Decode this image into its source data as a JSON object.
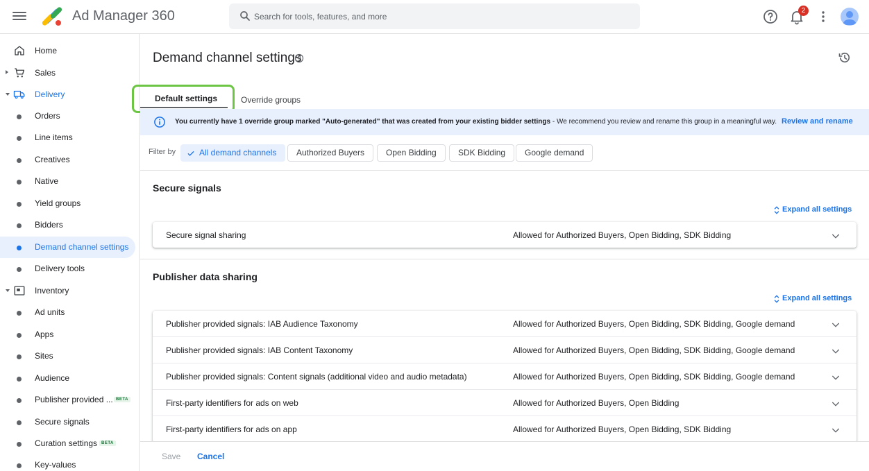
{
  "app": {
    "title": "Ad Manager 360"
  },
  "search": {
    "placeholder": "Search for tools, features, and more"
  },
  "header": {
    "notification_count": "2"
  },
  "sidebar": {
    "items": [
      {
        "label": "Home"
      },
      {
        "label": "Sales"
      },
      {
        "label": "Delivery"
      },
      {
        "label": "Orders"
      },
      {
        "label": "Line items"
      },
      {
        "label": "Creatives"
      },
      {
        "label": "Native"
      },
      {
        "label": "Yield groups"
      },
      {
        "label": "Bidders"
      },
      {
        "label": "Demand channel settings"
      },
      {
        "label": "Delivery tools"
      },
      {
        "label": "Inventory"
      },
      {
        "label": "Ad units"
      },
      {
        "label": "Apps"
      },
      {
        "label": "Sites"
      },
      {
        "label": "Audience"
      },
      {
        "label": "Publisher provided ..."
      },
      {
        "label": "Secure signals"
      },
      {
        "label": "Curation settings"
      },
      {
        "label": "Key-values"
      }
    ],
    "beta_label": "BETA"
  },
  "page": {
    "title": "Demand channel settings",
    "tabs": [
      {
        "label": "Default settings"
      },
      {
        "label": "Override groups"
      }
    ],
    "banner": {
      "message_bold": "You currently have 1 override group marked \"Auto-generated\" that was created from your existing bidder settings",
      "message_rest": " - We recommend you review and rename this group in a meaningful way.",
      "action": "Review and rename"
    },
    "filter": {
      "label": "Filter by",
      "chips": [
        "All demand channels",
        "Authorized Buyers",
        "Open Bidding",
        "SDK Bidding",
        "Google demand"
      ]
    },
    "expand_all_label": "Expand all settings",
    "sections": [
      {
        "title": "Secure signals",
        "rows": [
          {
            "name": "Secure signal sharing",
            "value": "Allowed for Authorized Buyers, Open Bidding, SDK Bidding"
          }
        ]
      },
      {
        "title": "Publisher data sharing",
        "rows": [
          {
            "name": "Publisher provided signals: IAB Audience Taxonomy",
            "value": "Allowed for Authorized Buyers, Open Bidding, SDK Bidding, Google demand"
          },
          {
            "name": "Publisher provided signals: IAB Content Taxonomy",
            "value": "Allowed for Authorized Buyers, Open Bidding, SDK Bidding, Google demand"
          },
          {
            "name": "Publisher provided signals: Content signals (additional video and audio metadata)",
            "value": "Allowed for Authorized Buyers, Open Bidding, SDK Bidding, Google demand"
          },
          {
            "name": "First-party identifiers for ads on web",
            "value": "Allowed for Authorized Buyers, Open Bidding"
          },
          {
            "name": "First-party identifiers for ads on app",
            "value": "Allowed for Authorized Buyers, Open Bidding, SDK Bidding"
          }
        ]
      }
    ],
    "footer": {
      "save": "Save",
      "cancel": "Cancel"
    }
  },
  "colors": {
    "accent": "#1a73e8",
    "highlight": "#6cc644",
    "banner_bg": "#e8f0fe",
    "badge": "#d93025"
  }
}
